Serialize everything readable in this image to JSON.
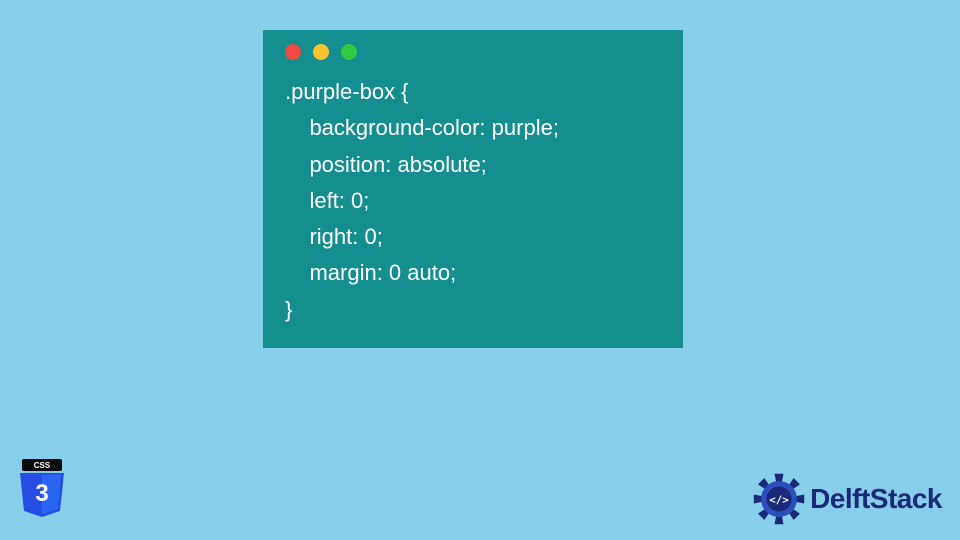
{
  "code_window": {
    "lines": [
      ".purple-box {",
      "    background-color: purple;",
      "    position: absolute;",
      "    left: 0;",
      "    right: 0;",
      "    margin: 0 auto;",
      "}"
    ]
  },
  "css_badge": {
    "label_top": "CSS",
    "label_main": "3"
  },
  "brand": {
    "name": "DelftStack"
  },
  "colors": {
    "page_bg": "#87ceeb",
    "window_bg": "#148e8e",
    "code_text": "#ffffff",
    "brand_text": "#1b2a78",
    "css_shield": "#2965f1",
    "css_shield_dark": "#264de4"
  }
}
